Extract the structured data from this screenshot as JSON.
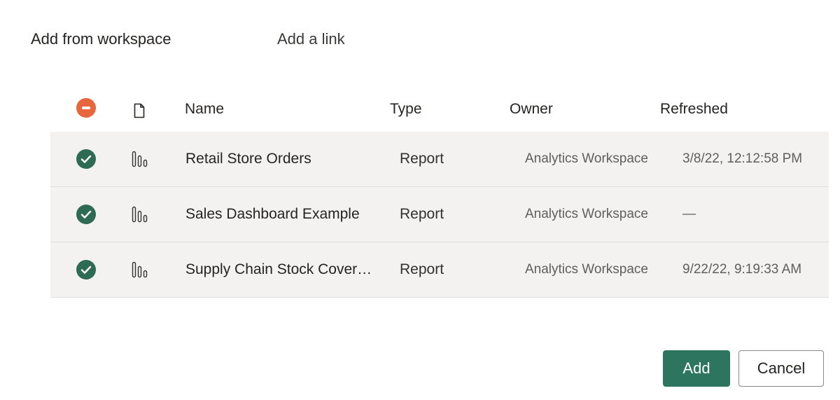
{
  "tabs": {
    "workspace": "Add from workspace",
    "link": "Add a link"
  },
  "table": {
    "headers": {
      "name": "Name",
      "type": "Type",
      "owner": "Owner",
      "refreshed": "Refreshed"
    },
    "rows": [
      {
        "name": "Retail Store Orders",
        "type": "Report",
        "owner": "Analytics Workspace",
        "refreshed": "3/8/22, 12:12:58 PM",
        "selected": true
      },
      {
        "name": "Sales Dashboard Example",
        "type": "Report",
        "owner": "Analytics Workspace",
        "refreshed": "—",
        "selected": true
      },
      {
        "name": "Supply Chain Stock Cover…",
        "type": "Report",
        "owner": "Analytics Workspace",
        "refreshed": "9/22/22, 9:19:33 AM",
        "selected": true
      }
    ]
  },
  "icons": {
    "deselect_all": "minus-circle-icon",
    "type_column": "document-icon",
    "row_selected": "checkmark-circle-icon",
    "report": "bar-chart-icon"
  },
  "buttons": {
    "add": "Add",
    "cancel": "Cancel"
  },
  "colors": {
    "primary": "#2e7560",
    "check": "#2e6b55",
    "deselect": "#e8663d",
    "row_background": "#f3f2f1"
  }
}
